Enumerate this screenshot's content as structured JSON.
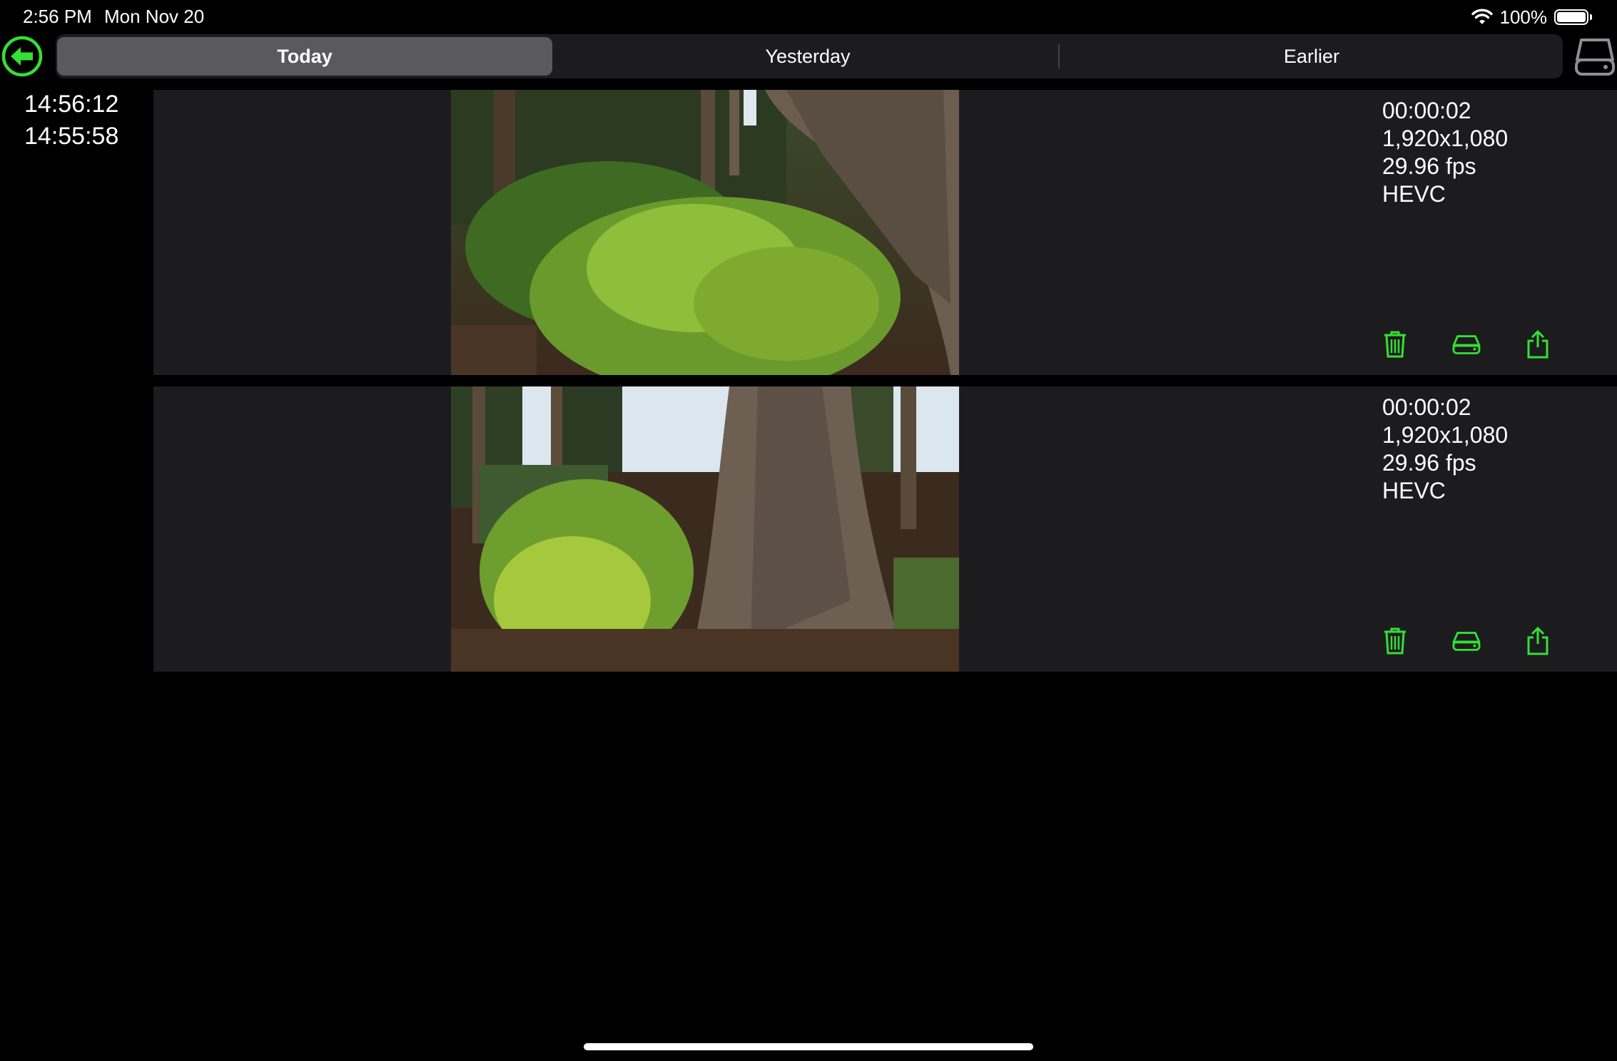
{
  "status_bar": {
    "time": "2:56 PM",
    "date": "Mon Nov 20",
    "battery": "100%"
  },
  "tabs": [
    {
      "label": "Today",
      "selected": true
    },
    {
      "label": "Yesterday",
      "selected": false
    },
    {
      "label": "Earlier",
      "selected": false
    }
  ],
  "times": [
    "14:56:12",
    "14:55:58"
  ],
  "videos": [
    {
      "duration": "00:00:02",
      "resolution": "1,920x1,080",
      "fps": "29.96 fps",
      "codec": "HEVC"
    },
    {
      "duration": "00:00:02",
      "resolution": "1,920x1,080",
      "fps": "29.96 fps",
      "codec": "HEVC"
    }
  ],
  "colors": {
    "accent": "#34e034",
    "row_bg": "#1c1c1e",
    "segment_selected": "#5a5a5e"
  },
  "icons": {
    "back": "arrow-left-circle-icon",
    "drive": "external-drive-icon",
    "delete": "trash-icon",
    "save": "drive-icon",
    "share": "share-icon"
  }
}
